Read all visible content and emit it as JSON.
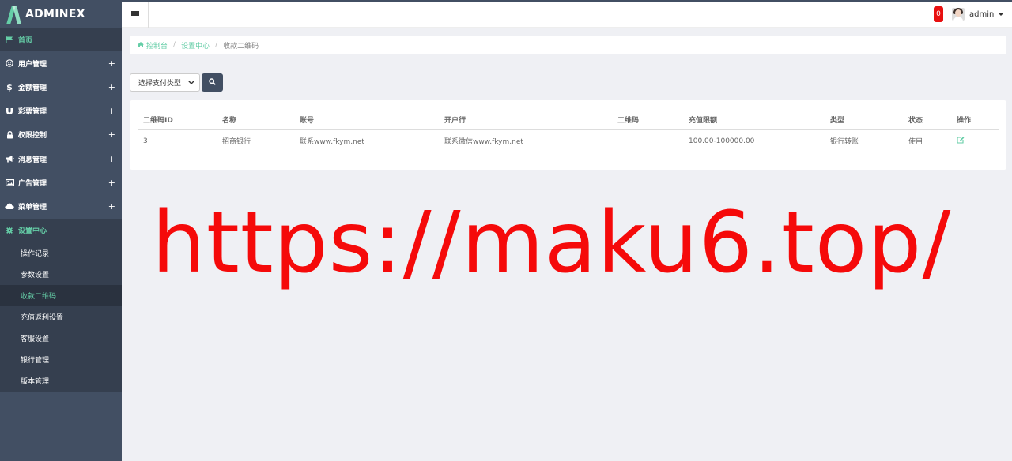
{
  "logo": {
    "text_a": "ADMIN",
    "text_b": "EX"
  },
  "sidebar": {
    "items": [
      {
        "label": "首页",
        "icon": "flag-icon",
        "toggle": ""
      },
      {
        "label": "用户管理",
        "icon": "smile-icon",
        "toggle": "+"
      },
      {
        "label": "金额管理",
        "icon": "dollar-icon",
        "toggle": "+"
      },
      {
        "label": "彩票管理",
        "icon": "magnet-icon",
        "toggle": "+"
      },
      {
        "label": "权限控制",
        "icon": "lock-icon",
        "toggle": "+"
      },
      {
        "label": "消息管理",
        "icon": "bullhorn-icon",
        "toggle": "+"
      },
      {
        "label": "广告管理",
        "icon": "image-icon",
        "toggle": "+"
      },
      {
        "label": "菜单管理",
        "icon": "cloud-icon",
        "toggle": "+"
      },
      {
        "label": "设置中心",
        "icon": "gear-icon",
        "toggle": "−"
      }
    ],
    "submenu": [
      "操作记录",
      "参数设置",
      "收款二维码",
      "充值返利设置",
      "客服设置",
      "银行管理",
      "版本管理"
    ]
  },
  "header": {
    "badge": "0",
    "username": "admin"
  },
  "breadcrumb": {
    "home": "控制台",
    "section": "设置中心",
    "current": "收款二维码"
  },
  "filter": {
    "select_label": "选择支付类型"
  },
  "table": {
    "headers": [
      "二维码ID",
      "名称",
      "账号",
      "开户行",
      "二维码",
      "充值限额",
      "类型",
      "状态",
      "操作"
    ],
    "rows": [
      [
        "3",
        "招商银行",
        "联系www.fkym.net",
        "联系微信www.fkym.net",
        "",
        "100.00-100000.00",
        "银行转账",
        "使用"
      ]
    ]
  },
  "watermark": "https://maku6.top/",
  "colors": {
    "sidebar": "#424f63",
    "accent": "#65cea7",
    "badge": "#e81010",
    "watermark": "#f50a0a"
  }
}
